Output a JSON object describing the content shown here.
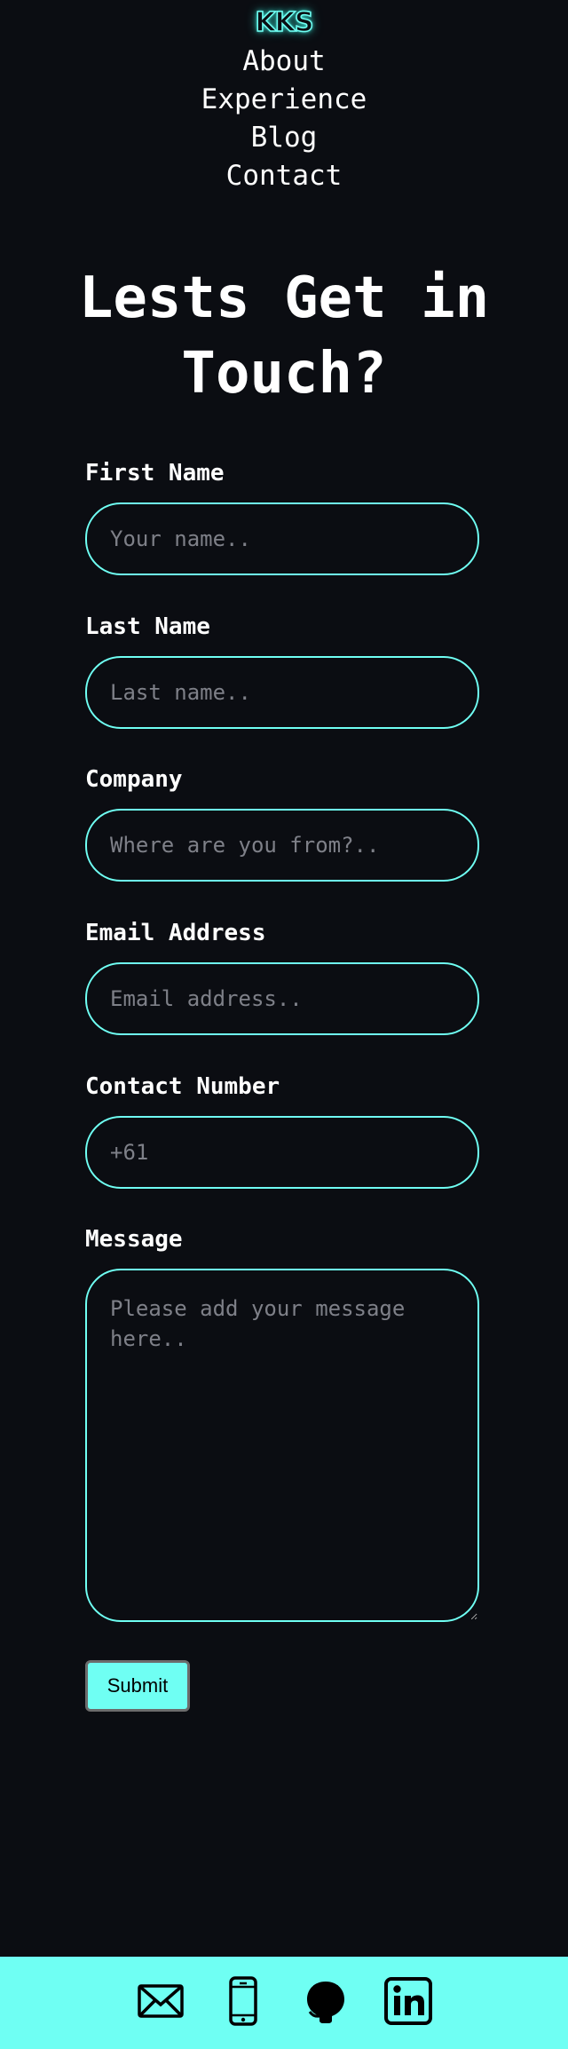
{
  "header": {
    "logo_text": "KKS",
    "nav": [
      {
        "label": "About"
      },
      {
        "label": "Experience"
      },
      {
        "label": "Blog"
      },
      {
        "label": "Contact"
      }
    ]
  },
  "main": {
    "title": "Lests Get in Touch?",
    "form": {
      "first_name": {
        "label": "First Name",
        "placeholder": "Your name.."
      },
      "last_name": {
        "label": "Last Name",
        "placeholder": "Last name.."
      },
      "company": {
        "label": "Company",
        "placeholder": "Where are you from?.."
      },
      "email": {
        "label": "Email Address",
        "placeholder": "Email address.."
      },
      "contact_number": {
        "label": "Contact Number",
        "placeholder": "+61"
      },
      "message": {
        "label": "Message",
        "placeholder": "Please add your message here.."
      },
      "submit_label": "Submit"
    }
  },
  "footer": {
    "icons": [
      "mail-icon",
      "mobile-phone-icon",
      "github-icon",
      "linkedin-icon"
    ]
  },
  "colors": {
    "background": "#0b0d12",
    "accent": "#6ffff3",
    "text": "#ffffff",
    "placeholder": "#7e8088"
  }
}
